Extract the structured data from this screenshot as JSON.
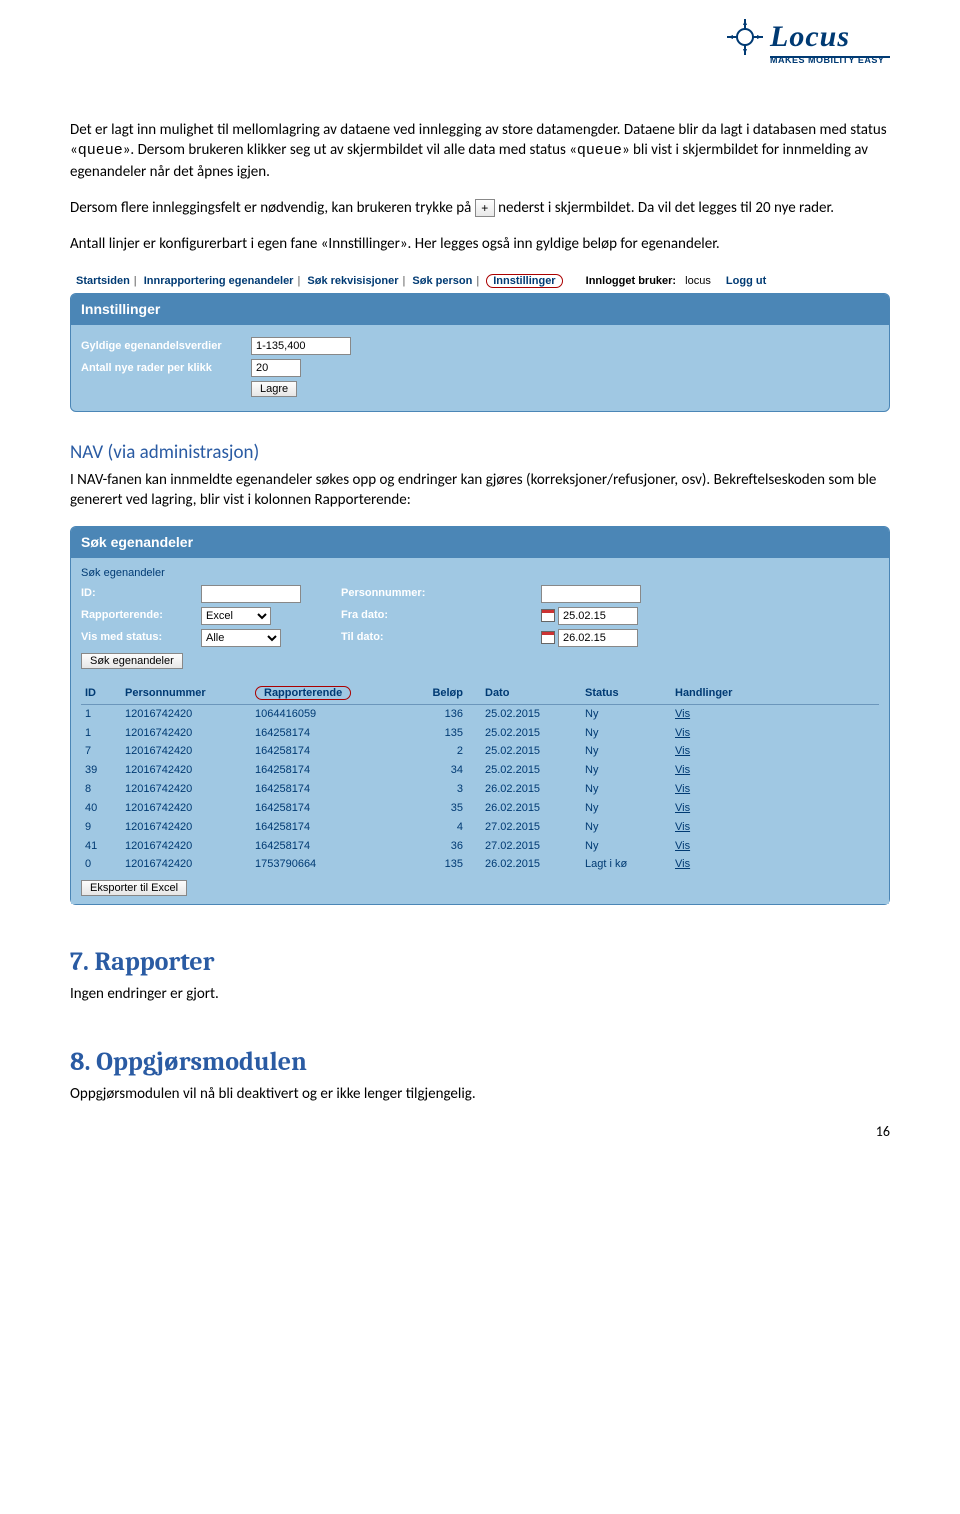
{
  "logo": {
    "name": "Locus",
    "tagline": "MAKES MOBILITY EASY"
  },
  "para1a": "Det er lagt inn mulighet til mellomlagring av dataene ved innlegging av store datamengder. Dataene blir da lagt i databasen med status «",
  "para1_code1": "queue",
  "para1b": "». Dersom brukeren klikker seg ut av skjermbildet vil alle data med status «",
  "para1_code2": "queue",
  "para1c": "» bli vist i skjermbildet for innmelding av egenandeler når det åpnes igjen.",
  "para2a": "Dersom flere innleggingsfelt er nødvendig, kan brukeren trykke på ",
  "plus_symbol": "+",
  "para2b": " nederst i skjermbildet. Da vil det legges til 20 nye rader.",
  "para3": "Antall linjer er konfigurerbart i egen fane «Innstillinger». Her legges også inn gyldige beløp for egenandeler.",
  "ss1": {
    "nav": {
      "items": [
        "Startsiden",
        "Innrapportering egenandeler",
        "Søk rekvisisjoner",
        "Søk person",
        "Innstillinger"
      ],
      "logged_label": "Innlogget bruker:",
      "logged_user": "locus",
      "logout": "Logg ut"
    },
    "panel_title": "Innstillinger",
    "field1_label": "Gyldige egenandelsverdier",
    "field1_value": "1-135,400",
    "field2_label": "Antall nye rader per klikk",
    "field2_value": "20",
    "save_btn": "Lagre"
  },
  "heading_nav": "NAV (via administrasjon)",
  "para_nav": "I NAV-fanen kan innmeldte egenandeler søkes opp og endringer kan gjøres (korreksjoner/refusjoner, osv). Bekreftelseskoden som ble generert ved lagring, blir vist i kolonnen Rapporterende:",
  "ss2": {
    "panel_title": "Søk egenandeler",
    "subhead": "Søk egenandeler",
    "labels": {
      "id": "ID:",
      "pnr": "Personnummer:",
      "rap": "Rapporterende:",
      "fra": "Fra dato:",
      "vis": "Vis med status:",
      "til": "Til dato:"
    },
    "rap_value": "Excel",
    "vis_value": "Alle",
    "fra_value": "25.02.15",
    "til_value": "26.02.15",
    "search_btn": "Søk egenandeler",
    "cols": [
      "ID",
      "Personnummer",
      "Rapporterende",
      "Beløp",
      "Dato",
      "Status",
      "Handlinger"
    ],
    "rows": [
      {
        "id": "1",
        "pnr": "12016742420",
        "rap": "1064416059",
        "belop": "136",
        "dato": "25.02.2015",
        "status": "Ny",
        "act": "Vis"
      },
      {
        "id": "1",
        "pnr": "12016742420",
        "rap": "164258174",
        "belop": "135",
        "dato": "25.02.2015",
        "status": "Ny",
        "act": "Vis"
      },
      {
        "id": "7",
        "pnr": "12016742420",
        "rap": "164258174",
        "belop": "2",
        "dato": "25.02.2015",
        "status": "Ny",
        "act": "Vis"
      },
      {
        "id": "39",
        "pnr": "12016742420",
        "rap": "164258174",
        "belop": "34",
        "dato": "25.02.2015",
        "status": "Ny",
        "act": "Vis"
      },
      {
        "id": "8",
        "pnr": "12016742420",
        "rap": "164258174",
        "belop": "3",
        "dato": "26.02.2015",
        "status": "Ny",
        "act": "Vis"
      },
      {
        "id": "40",
        "pnr": "12016742420",
        "rap": "164258174",
        "belop": "35",
        "dato": "26.02.2015",
        "status": "Ny",
        "act": "Vis"
      },
      {
        "id": "9",
        "pnr": "12016742420",
        "rap": "164258174",
        "belop": "4",
        "dato": "27.02.2015",
        "status": "Ny",
        "act": "Vis"
      },
      {
        "id": "41",
        "pnr": "12016742420",
        "rap": "164258174",
        "belop": "36",
        "dato": "27.02.2015",
        "status": "Ny",
        "act": "Vis"
      },
      {
        "id": "0",
        "pnr": "12016742420",
        "rap": "1753790664",
        "belop": "135",
        "dato": "26.02.2015",
        "status": "Lagt i kø",
        "act": "Vis"
      }
    ],
    "export_btn": "Eksporter til Excel"
  },
  "heading_7": "7.  Rapporter",
  "para_7": "Ingen endringer er gjort.",
  "heading_8": "8.  Oppgjørsmodulen",
  "para_8": "Oppgjørsmodulen vil nå bli deaktivert og er ikke lenger tilgjengelig.",
  "page_number": "16"
}
